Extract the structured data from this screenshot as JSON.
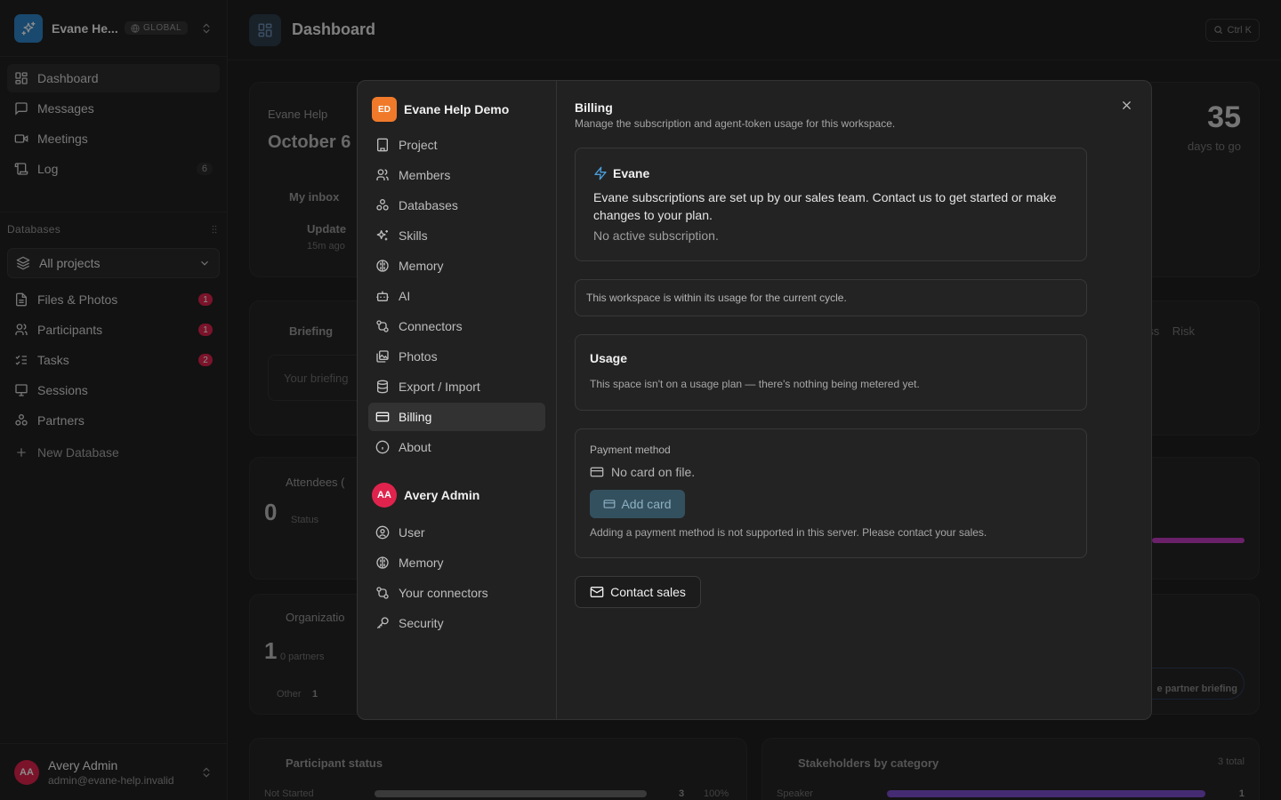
{
  "sidebar": {
    "workspace_name": "Evane He...",
    "workspace_badge": "GLOBAL",
    "nav": [
      {
        "label": "Dashboard"
      },
      {
        "label": "Messages"
      },
      {
        "label": "Meetings"
      },
      {
        "label": "Log",
        "count": "6"
      }
    ],
    "databases_heading": "Databases",
    "project_select": "All projects",
    "databases": [
      {
        "label": "Files & Photos",
        "badge": "1"
      },
      {
        "label": "Participants",
        "badge": "1"
      },
      {
        "label": "Tasks",
        "badge": "2"
      },
      {
        "label": "Sessions"
      },
      {
        "label": "Partners"
      }
    ],
    "new_database": "New Database",
    "user": {
      "initials": "AA",
      "name": "Avery Admin",
      "email": "admin@evane-help.invalid"
    }
  },
  "main": {
    "title": "Dashboard",
    "shortcut": "Ctrl K",
    "bg": {
      "cal_label": "Evane Help",
      "date": "October 6",
      "inbox": "My inbox",
      "update": "Update",
      "update_time": "15m ago",
      "days_num": "35",
      "days_label": "days to go",
      "briefing": "Briefing",
      "briefing_ph": "Your briefing",
      "risk_tabs": "ss    Risk",
      "attendees": "Attendees (",
      "att_num": "0",
      "att_status": "Status",
      "orgs": "Organizatio",
      "org_num": "1",
      "org_partners": "0 partners",
      "org_other": "Other",
      "org_other_n": "1",
      "partner_briefing": "e partner briefing",
      "participant_status": "Participant status",
      "not_started": "Not Started",
      "ns_count": "3",
      "ns_pct": "100%",
      "stakeholders": "Stakeholders by category",
      "total": "3 total",
      "speaker": "Speaker",
      "speaker_n": "1"
    }
  },
  "modal": {
    "workspace_initials": "ED",
    "workspace_name": "Evane Help Demo",
    "workspace_items": [
      {
        "label": "Project",
        "icon": "building-icon"
      },
      {
        "label": "Members",
        "icon": "users-icon"
      },
      {
        "label": "Databases",
        "icon": "boxes-icon"
      },
      {
        "label": "Skills",
        "icon": "sparkles-icon"
      },
      {
        "label": "Memory",
        "icon": "brain-icon"
      },
      {
        "label": "AI",
        "icon": "bot-icon"
      },
      {
        "label": "Connectors",
        "icon": "connectors-icon"
      },
      {
        "label": "Photos",
        "icon": "photos-icon"
      },
      {
        "label": "Export / Import",
        "icon": "database-icon"
      },
      {
        "label": "Billing",
        "icon": "credit-card-icon",
        "active": true
      },
      {
        "label": "About",
        "icon": "info-icon"
      }
    ],
    "user_initials": "AA",
    "user_name": "Avery Admin",
    "user_items": [
      {
        "label": "User"
      },
      {
        "label": "Memory"
      },
      {
        "label": "Your connectors"
      },
      {
        "label": "Security"
      }
    ],
    "title": "Billing",
    "subtitle": "Manage the subscription and agent-token usage for this workspace.",
    "plan": {
      "name": "Evane",
      "text": "Evane subscriptions are set up by our sales team. Contact us to get started or make changes to your plan.",
      "status": "No active subscription."
    },
    "usage_note": "This workspace is within its usage for the current cycle.",
    "usage": {
      "title": "Usage",
      "text": "This space isn't on a usage plan — there's nothing being metered yet."
    },
    "payment": {
      "label": "Payment method",
      "none": "No card on file.",
      "add_card": "Add card",
      "help": "Adding a payment method is not supported in this server. Please contact your sales."
    },
    "contact_sales": "Contact sales"
  },
  "colors": {
    "accent": "#2f86c8",
    "badge": "#e0234d",
    "workspace_logo": "#f07a2a",
    "add_card_bg": "#33505f"
  }
}
